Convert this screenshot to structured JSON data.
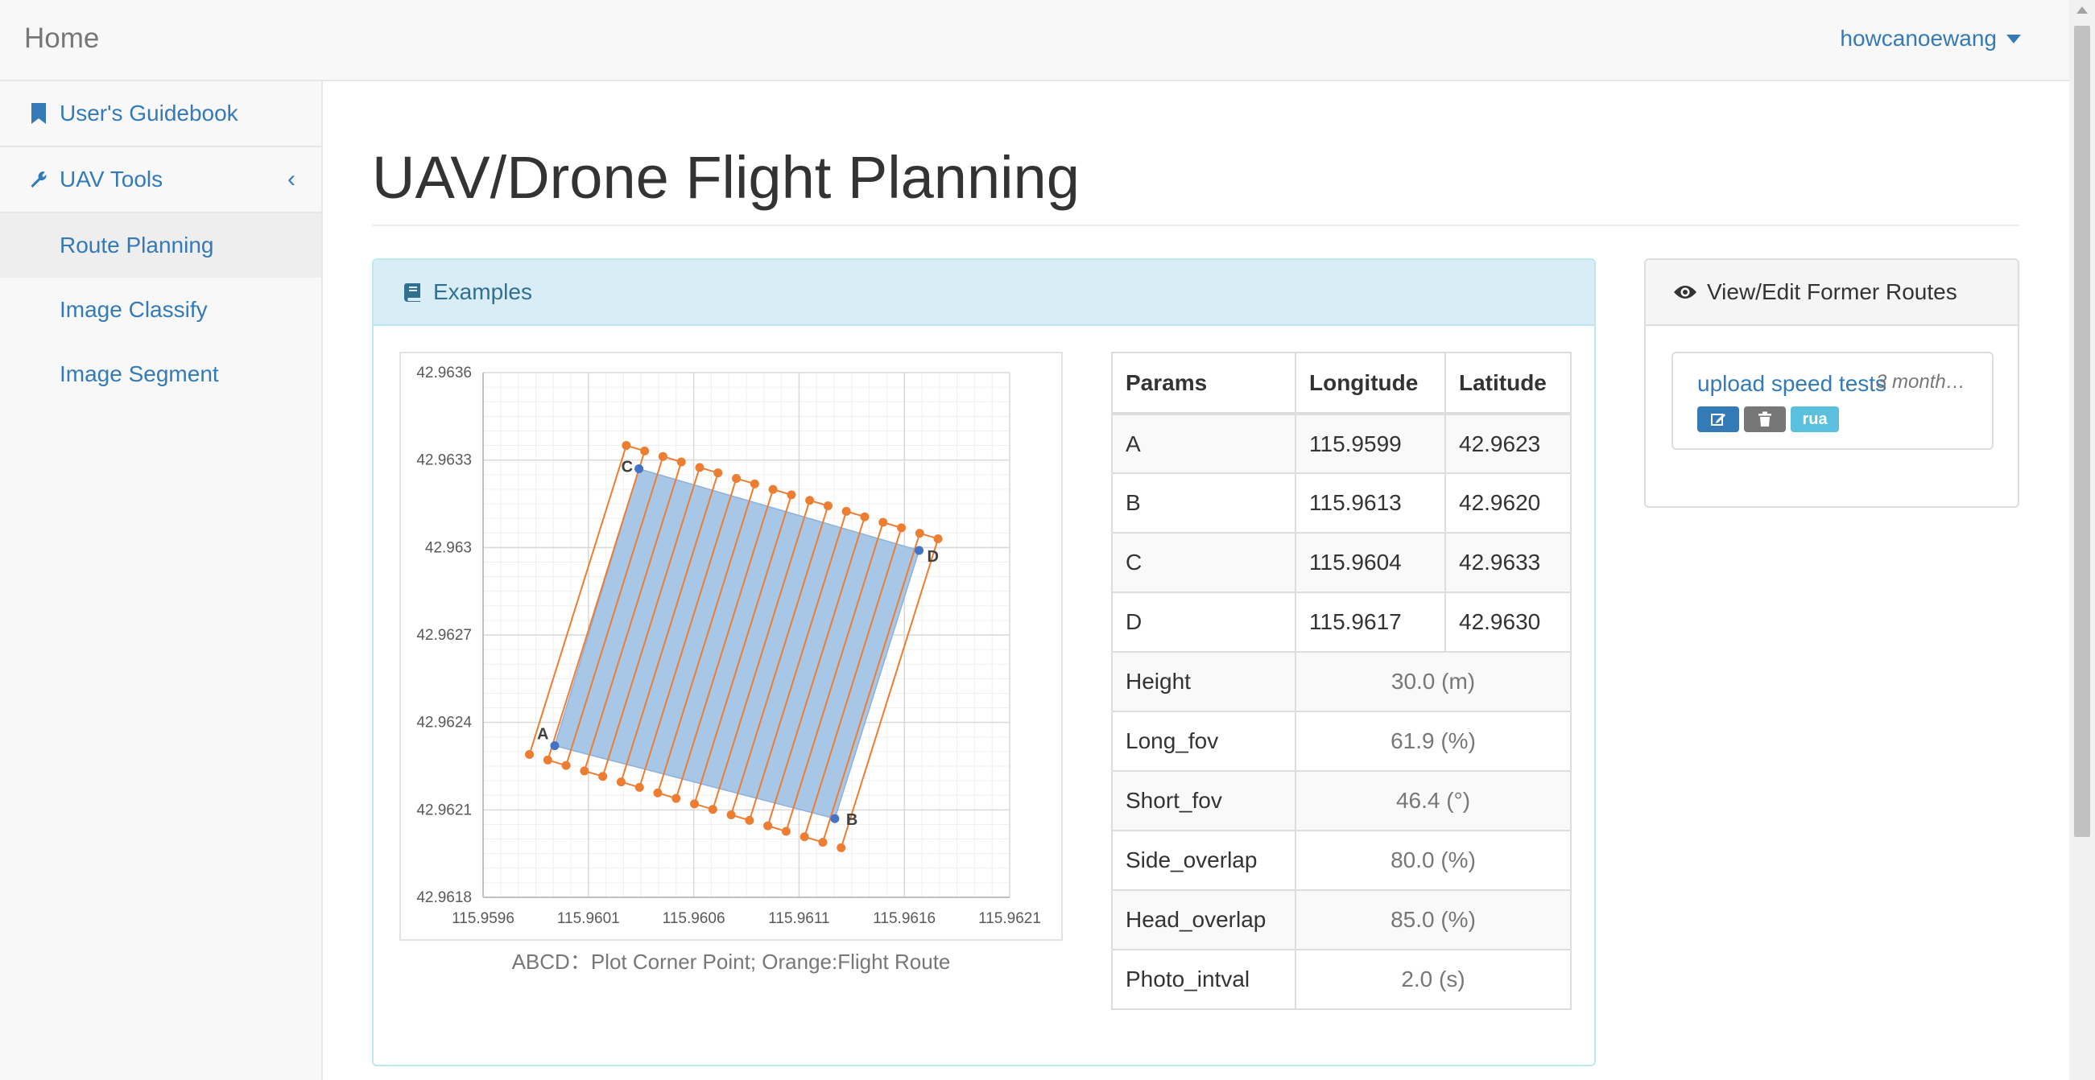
{
  "navbar": {
    "brand": "Home",
    "user": "howcanoewang"
  },
  "sidebar": {
    "guidebook": "User's Guidebook",
    "uav_tools": "UAV Tools",
    "items": [
      {
        "label": "Route Planning",
        "active": true
      },
      {
        "label": "Image Classify",
        "active": false
      },
      {
        "label": "Image Segment",
        "active": false
      }
    ]
  },
  "page": {
    "title": "UAV/Drone Flight Planning"
  },
  "examples": {
    "heading": "Examples",
    "caption": "ABCD：Plot Corner Point; Orange:Flight Route"
  },
  "params_table": {
    "headers": [
      "Params",
      "Longitude",
      "Latitude"
    ],
    "corners": [
      {
        "name": "A",
        "lon": "115.9599",
        "lat": "42.9623"
      },
      {
        "name": "B",
        "lon": "115.9613",
        "lat": "42.9620"
      },
      {
        "name": "C",
        "lon": "115.9604",
        "lat": "42.9633"
      },
      {
        "name": "D",
        "lon": "115.9617",
        "lat": "42.9630"
      }
    ],
    "settings": [
      {
        "name": "Height",
        "value": "30.0 (m)"
      },
      {
        "name": "Long_fov",
        "value": "61.9 (%)"
      },
      {
        "name": "Short_fov",
        "value": "46.4 (°)"
      },
      {
        "name": "Side_overlap",
        "value": "80.0 (%)"
      },
      {
        "name": "Head_overlap",
        "value": "85.0 (%)"
      },
      {
        "name": "Photo_intval",
        "value": "2.0 (s)"
      }
    ]
  },
  "former_routes": {
    "heading": "View/Edit Former Routes",
    "routes": [
      {
        "name": "upload speed tests",
        "time": "3 month…",
        "tag": "rua"
      }
    ]
  },
  "colors": {
    "plot_fill": "#a8c6e6",
    "route": "#ed7d31",
    "corner": "#4472c4",
    "link": "#337ab7"
  },
  "chart_data": {
    "type": "scatter",
    "title": "",
    "xlabel": "",
    "ylabel": "",
    "xlim": [
      115.9596,
      115.9621
    ],
    "ylim": [
      42.9618,
      42.9636
    ],
    "x_ticks": [
      "115.9596",
      "115.9601",
      "115.9606",
      "115.9611",
      "115.9616",
      "115.9621"
    ],
    "y_ticks": [
      "42.9636",
      "42.9633",
      "42.963",
      "42.9627",
      "42.9624",
      "42.9621",
      "42.9618"
    ],
    "grid": true,
    "plot_polygon": [
      [
        115.95994,
        42.96232
      ],
      [
        115.96127,
        42.96207
      ],
      [
        115.96167,
        42.96299
      ],
      [
        115.96034,
        42.96327
      ]
    ],
    "corner_points": [
      {
        "label": "A",
        "x": 115.95994,
        "y": 42.96232
      },
      {
        "label": "B",
        "x": 115.96127,
        "y": 42.96207
      },
      {
        "label": "C",
        "x": 115.96034,
        "y": 42.96327
      },
      {
        "label": "D",
        "x": 115.96167,
        "y": 42.96299
      }
    ],
    "route_bottom_start": [
      115.95982,
      42.96229
    ],
    "route_bottom_end": [
      115.9613,
      42.96197
    ],
    "route_top_start": [
      115.96028,
      42.96335
    ],
    "route_top_end": [
      115.96176,
      42.96303
    ],
    "route_legs": 18
  }
}
